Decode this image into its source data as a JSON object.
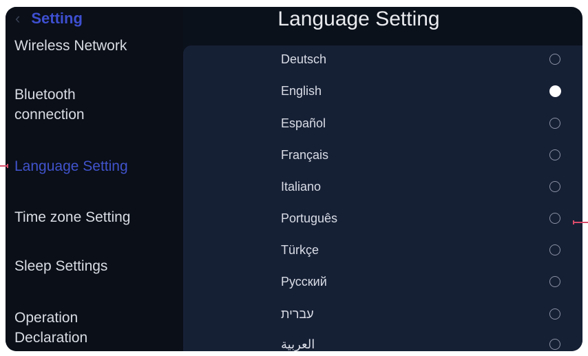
{
  "header": {
    "back_label": "Setting",
    "page_title": "Language Setting"
  },
  "sidebar": {
    "items": [
      {
        "label": "Wireless Network",
        "active": false
      },
      {
        "label": "Bluetooth\nconnection",
        "active": false
      },
      {
        "label": "Language Setting",
        "active": true
      },
      {
        "label": "Time zone Setting",
        "active": false
      },
      {
        "label": "Sleep Settings",
        "active": false
      },
      {
        "label": "Operation\nDeclaration",
        "active": false
      }
    ]
  },
  "languages": {
    "selected": "English",
    "items": [
      "Deutsch",
      "English",
      "Español",
      "Français",
      "Italiano",
      "Português",
      "Türkçe",
      "Русский",
      "עברית",
      "العربية"
    ]
  },
  "colors": {
    "accent": "#4153cc",
    "panel": "#162035",
    "background": "#0b111b",
    "pointer": "#d94c6a"
  },
  "icons": {
    "back": "chevron-left-icon",
    "radio": "radio-button-icon"
  }
}
